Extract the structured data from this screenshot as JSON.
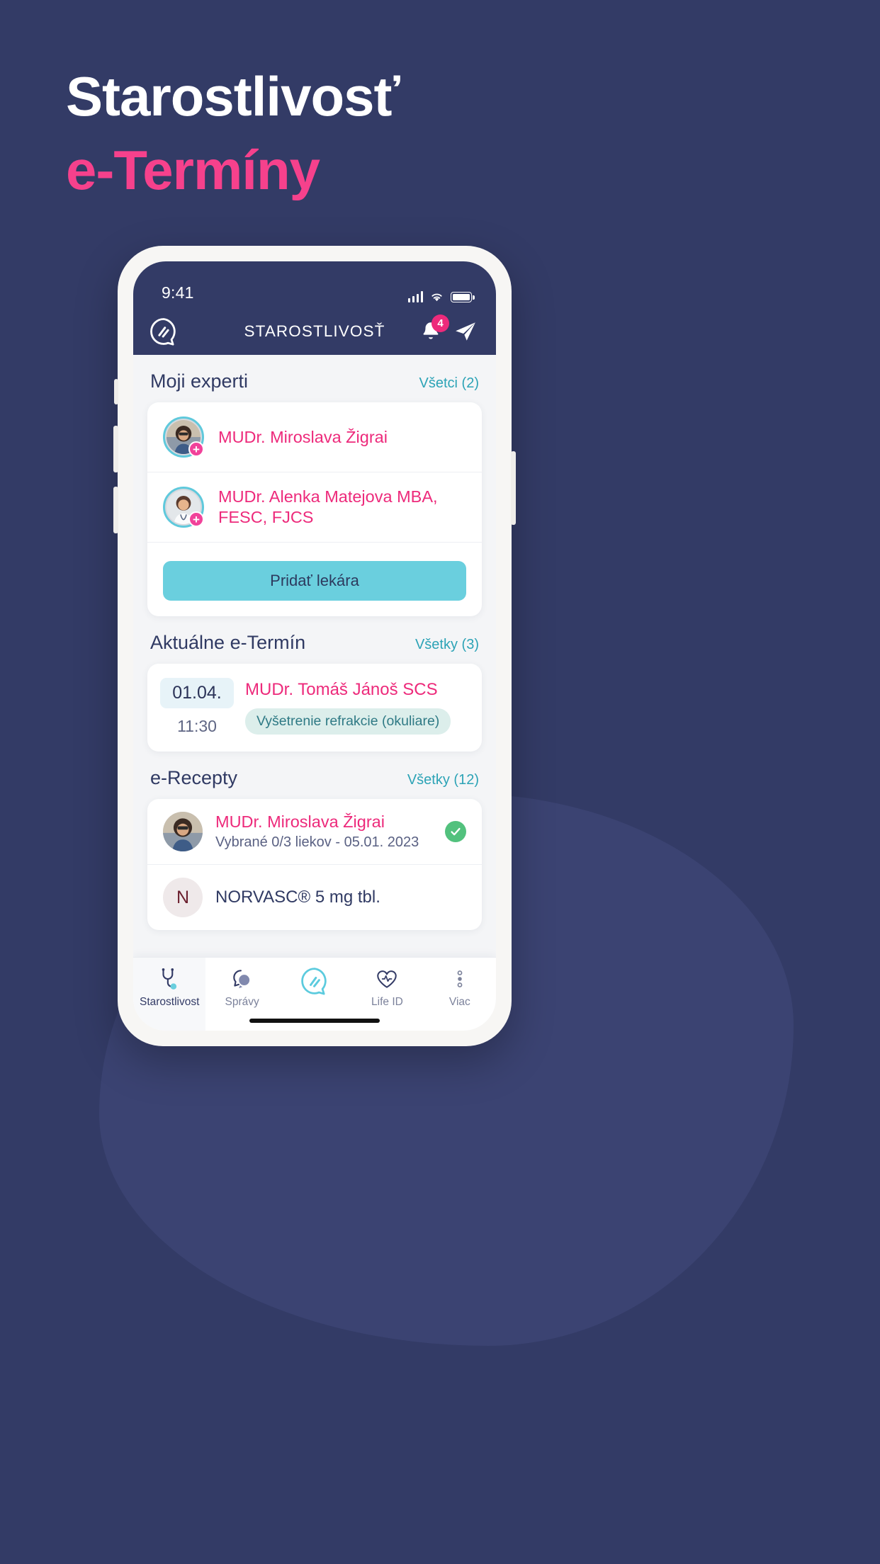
{
  "promo": {
    "line1": "Starostlivosť",
    "line2": "e-Termíny",
    "colors": {
      "background": "#333B66",
      "white": "#FFFFFF",
      "pink": "#F6418C"
    }
  },
  "status_bar": {
    "time": "9:41",
    "cellular_icon": "signal-bars-icon",
    "wifi_icon": "wifi-icon",
    "battery_icon": "battery-icon"
  },
  "app_bar": {
    "logo_icon": "app-logo-icon",
    "title": "STAROSTLIVOSŤ",
    "bell_icon": "bell-icon",
    "notification_count": "4",
    "send_icon": "paper-plane-icon"
  },
  "sections": {
    "experts": {
      "title": "Moji experti",
      "link": "Všetci (2)",
      "items": [
        {
          "name": "MUDr. Miroslava Žigrai",
          "badge": "+"
        },
        {
          "name": "MUDr. Alenka Matejova MBA, FESC, FJCS",
          "badge": "+"
        }
      ],
      "add_button": "Pridať lekára"
    },
    "appointments": {
      "title": "Aktuálne e-Termín",
      "link": "Všetky (3)",
      "items": [
        {
          "date": "01.04.",
          "time": "11:30",
          "doctor": "MUDr. Tomáš Jánoš SCS",
          "chip": "Vyšetrenie refrakcie (okuliare)"
        }
      ]
    },
    "prescriptions": {
      "title": "e-Recepty",
      "link": "Všetky (12)",
      "items": [
        {
          "doctor": "MUDr. Miroslava Žigrai",
          "subtitle": "Vybrané 0/3 liekov - 05.01. 2023",
          "status_icon": "check-circle-icon"
        }
      ],
      "medicines": [
        {
          "initial": "N",
          "name": "NORVASC® 5 mg tbl."
        }
      ]
    }
  },
  "tab_bar": {
    "tabs": [
      {
        "label": "Starostlivost",
        "icon": "stethoscope-icon",
        "active": true
      },
      {
        "label": "Správy",
        "icon": "chat-bubble-icon",
        "active": false
      },
      {
        "label": "",
        "icon": "app-logo-icon",
        "active": false
      },
      {
        "label": "Life ID",
        "icon": "heart-pulse-icon",
        "active": false
      },
      {
        "label": "Viac",
        "icon": "more-dots-icon",
        "active": false
      }
    ]
  },
  "theme": {
    "navy": "#333B66",
    "pink": "#ED2A7B",
    "teal": "#6ACFDE",
    "link_teal": "#2CA3B6",
    "green": "#52C17D"
  }
}
